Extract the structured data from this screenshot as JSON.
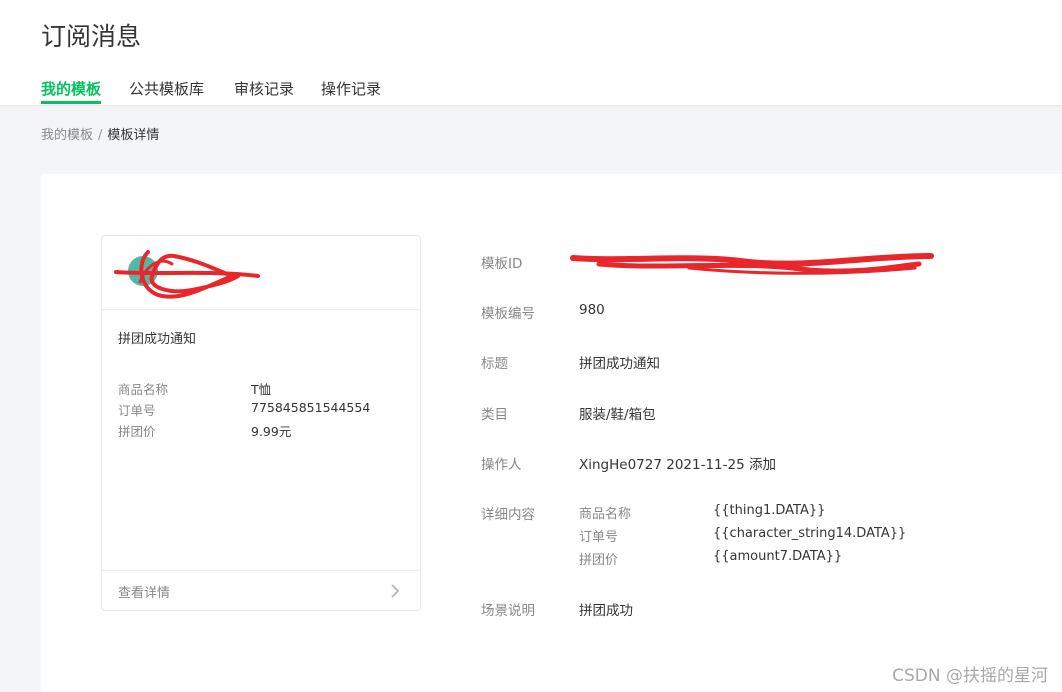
{
  "header": {
    "title": "订阅消息"
  },
  "tabs": [
    {
      "label": "我的模板",
      "active": true
    },
    {
      "label": "公共模板库",
      "active": false
    },
    {
      "label": "审核记录",
      "active": false
    },
    {
      "label": "操作记录",
      "active": false
    }
  ],
  "breadcrumb": {
    "parent": "我的模板",
    "separator": "/",
    "current": "模板详情"
  },
  "preview": {
    "title": "拼团成功通知",
    "rows": [
      {
        "key": "商品名称",
        "value": "T恤"
      },
      {
        "key": "订单号",
        "value": "775845851544554"
      },
      {
        "key": "拼团价",
        "value": "9.99元"
      }
    ],
    "footer_label": "查看详情",
    "chevron_icon": "chevron-right-icon"
  },
  "info": {
    "template_id_label": "模板ID",
    "template_no_label": "模板编号",
    "template_no": "980",
    "title_label": "标题",
    "title": "拼团成功通知",
    "category_label": "类目",
    "category": "服装/鞋/箱包",
    "operator_label": "操作人",
    "operator": "XingHe0727 2021-11-25 添加",
    "detail_label": "详细内容",
    "details": [
      {
        "key": "商品名称",
        "value": "{{thing1.DATA}}"
      },
      {
        "key": "订单号",
        "value": "{{character_string14.DATA}}"
      },
      {
        "key": "拼团价",
        "value": "{{amount7.DATA}}"
      }
    ],
    "scene_label": "场景说明",
    "scene": "拼团成功"
  },
  "watermark": "CSDN @扶摇的星河",
  "colors": {
    "accent": "#07c160",
    "redaction": "#e8262b"
  }
}
